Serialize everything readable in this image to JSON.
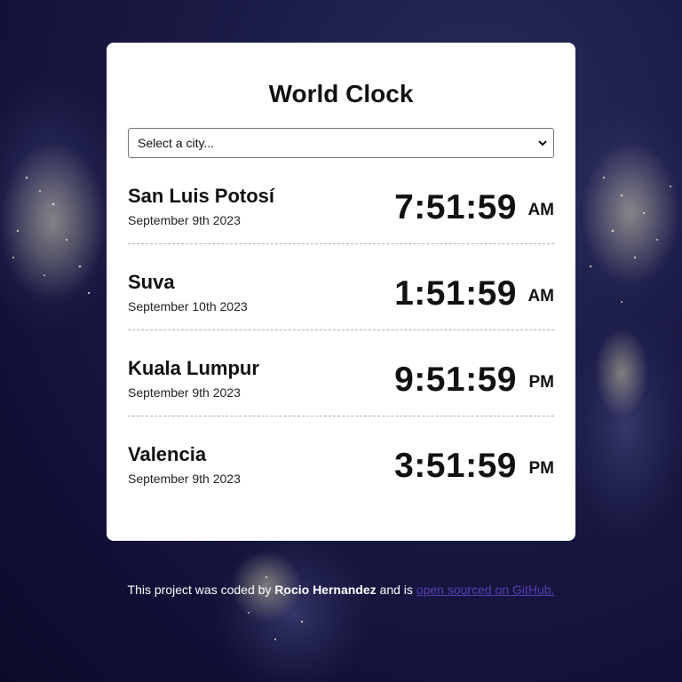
{
  "app": {
    "title": "World Clock"
  },
  "city_select": {
    "selected": "Select a city..."
  },
  "cities": [
    {
      "name": "San Luis Potosí",
      "date": "September 9th 2023",
      "time": "7:51:59",
      "ampm": "AM"
    },
    {
      "name": "Suva",
      "date": "September 10th 2023",
      "time": "1:51:59",
      "ampm": "AM"
    },
    {
      "name": "Kuala Lumpur",
      "date": "September 9th 2023",
      "time": "9:51:59",
      "ampm": "PM"
    },
    {
      "name": "Valencia",
      "date": "September 9th 2023",
      "time": "3:51:59",
      "ampm": "PM"
    }
  ],
  "footer": {
    "prefix": "This project was coded by",
    "author": "Rocio Hernandez",
    "middle": "and is",
    "link_text": "open sourced on GitHub."
  },
  "colors": {
    "background": "#1c1c48",
    "card": "#ffffff",
    "link": "#5b3fb5"
  },
  "icons": {
    "select_arrow": "chevron-down-icon",
    "background": "world-map-night-lights"
  }
}
